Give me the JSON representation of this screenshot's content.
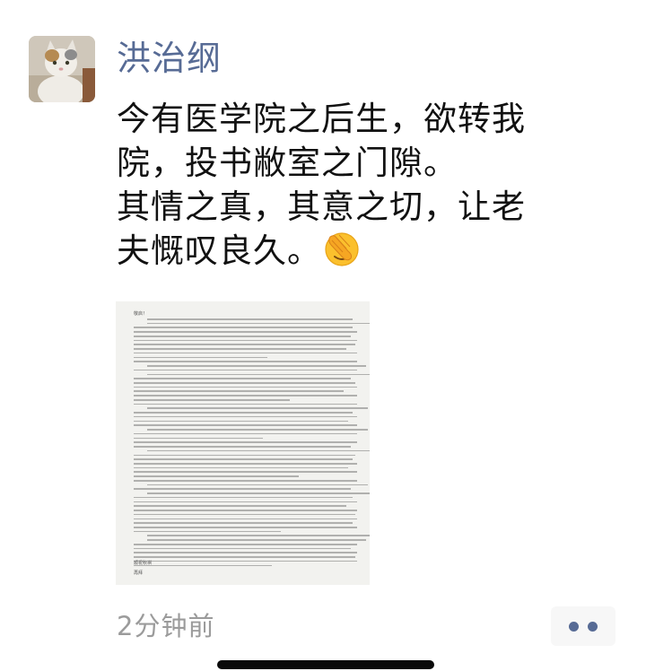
{
  "post": {
    "author": "洪治纲",
    "lines": [
      "今有医学院之后生，欲转我",
      "院，投书敝室之门隙。",
      "其情之真，其意之切，让老",
      "夫慨叹良久。"
    ],
    "emoji": "face-with-hand-over-eyes-emoji",
    "timestamp": "2分钟前"
  },
  "letter": {
    "salutation": "敬启！",
    "signature_lines": [
      "顺祝秋祺",
      "再拜"
    ]
  },
  "icons": {
    "avatar": "cat-avatar",
    "more": "more-dots-icon"
  },
  "colors": {
    "author": "#576b95",
    "timestamp": "#9b9b9b",
    "more_dots": "#576b95"
  }
}
